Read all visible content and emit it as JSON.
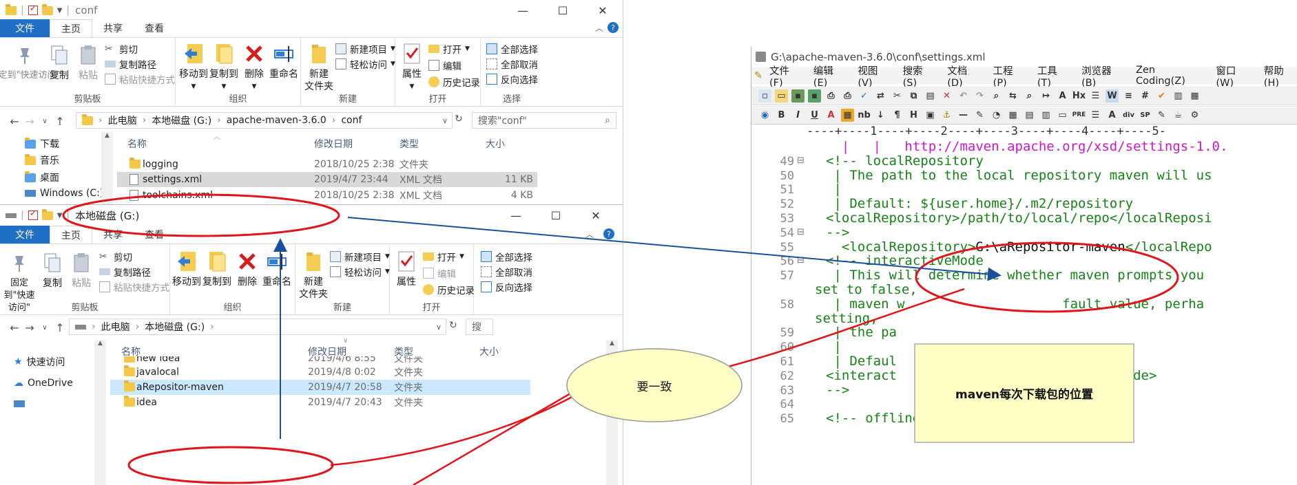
{
  "explorer1": {
    "title": "conf",
    "tabs": [
      "文件",
      "主页",
      "共享",
      "查看"
    ],
    "groups": {
      "clipboard": "剪贴板",
      "organize": "组织",
      "new": "新建",
      "open": "打开",
      "select": "选择"
    },
    "buttons": {
      "pin": "固定到\"快速访问\"",
      "copy": "复制",
      "paste": "粘贴",
      "cut": "剪切",
      "copy_path": "复制路径",
      "paste_shortcut": "粘贴快捷方式",
      "move_to": "移动到",
      "copy_to": "复制到",
      "delete": "删除",
      "rename": "重命名",
      "new_folder": "新建\n文件夹",
      "new_item": "新建项目",
      "easy_access": "轻松访问",
      "properties": "属性",
      "open": "打开",
      "edit": "编辑",
      "history": "历史记录",
      "select_all": "全部选择",
      "select_none": "全部取消",
      "invert": "反向选择"
    },
    "breadcrumb": [
      "此电脑",
      "本地磁盘 (G:)",
      "apache-maven-3.6.0",
      "conf"
    ],
    "search_placeholder": "搜索\"conf\"",
    "columns": [
      "名称",
      "修改日期",
      "类型",
      "大小"
    ],
    "nav": [
      "下载",
      "音乐",
      "桌面",
      "Windows (C:)"
    ],
    "files": [
      {
        "name": "logging",
        "date": "2018/10/25 2:38",
        "type": "文件夹",
        "size": ""
      },
      {
        "name": "settings.xml",
        "date": "2019/4/7 23:44",
        "type": "XML 文档",
        "size": "11 KB"
      },
      {
        "name": "toolchains.xml",
        "date": "2018/10/25 2:38",
        "type": "XML 文档",
        "size": "4 KB"
      }
    ]
  },
  "explorer2": {
    "title": "本地磁盘 (G:)",
    "tabs": [
      "文件",
      "主页",
      "共享",
      "查看"
    ],
    "groups": {
      "clipboard": "剪贴板",
      "organize": "组织",
      "new": "新建",
      "open": "打开"
    },
    "buttons": {
      "pin": "固定到\"快速访问\"",
      "copy": "复制",
      "paste": "粘贴",
      "cut": "剪切",
      "copy_path": "复制路径",
      "paste_shortcut": "粘贴快捷方式",
      "move_to": "移动到",
      "copy_to": "复制到",
      "delete": "删除",
      "rename": "重命名",
      "new_folder": "新建\n文件夹",
      "new_item": "新建项目",
      "easy_access": "轻松访问",
      "properties": "属性",
      "open": "打开",
      "edit": "编辑",
      "history": "历史记录",
      "select_all": "全部选择",
      "select_none": "全部取消",
      "invert": "反向选择"
    },
    "breadcrumb": [
      "此电脑",
      "本地磁盘 (G:)"
    ],
    "search_placeholder": "搜",
    "columns": [
      "名称",
      "修改日期",
      "类型",
      "大小"
    ],
    "nav": [
      "快速访问",
      "OneDrive"
    ],
    "files": [
      {
        "name": "new idea",
        "date": "2019/4/6 8:55",
        "type": "文件夹"
      },
      {
        "name": "javalocal",
        "date": "2019/4/8 0:02",
        "type": "文件夹"
      },
      {
        "name": "aRepositor-maven",
        "date": "2019/4/7 20:58",
        "type": "文件夹"
      },
      {
        "name": "idea",
        "date": "2019/4/7 20:43",
        "type": "文件夹"
      }
    ]
  },
  "editor": {
    "title": "G:\\apache-maven-3.6.0\\conf\\settings.xml",
    "menu": [
      "文件(F)",
      "编辑(E)",
      "视图(V)",
      "搜索(S)",
      "文档(D)",
      "工程(P)",
      "工具(T)",
      "浏览器(B)",
      "Zen Coding(Z)",
      "窗口(W)",
      "帮助(H)"
    ],
    "ruler": "----+----1----+----2----+----3----+----4----+----5-",
    "lines": [
      {
        "n": "",
        "text": "  |   |   http://maven.apache.org/xsd/settings-1.0.",
        "color": "mag"
      },
      {
        "n": "49",
        "text": "<!-- localRepository",
        "color": "green"
      },
      {
        "n": "50",
        "text": " | The path to the local repository maven will us",
        "color": "green"
      },
      {
        "n": "51",
        "text": " |",
        "color": "green"
      },
      {
        "n": "52",
        "text": " | Default: ${user.home}/.m2/repository",
        "color": "green"
      },
      {
        "n": "53",
        "text": "<localRepository>/path/to/local/repo</localReposi",
        "color": "green"
      },
      {
        "n": "54",
        "text": "-->",
        "color": "green"
      },
      {
        "n": "55",
        "text": "  <localRepository>G:\\aRepositor-maven</localRepo",
        "color": "mixed"
      },
      {
        "n": "56",
        "text": "<!-- interactiveMode",
        "color": "green"
      },
      {
        "n": "57",
        "text": " | This will determine whether maven prompts you ",
        "color": "green"
      },
      {
        "n": "",
        "text": "set to false,",
        "color": "green"
      },
      {
        "n": "58",
        "text": " | maven w                    fault value, perha",
        "color": "green"
      },
      {
        "n": "",
        "text": "setting,",
        "color": "green"
      },
      {
        "n": "59",
        "text": " | the pa",
        "color": "green"
      },
      {
        "n": "60",
        "text": " |",
        "color": "green"
      },
      {
        "n": "61",
        "text": " | Defaul",
        "color": "green"
      },
      {
        "n": "62",
        "text": "<interact                          veMode>",
        "color": "green"
      },
      {
        "n": "63",
        "text": "-->",
        "color": "green"
      },
      {
        "n": "64",
        "text": "",
        "color": "green"
      },
      {
        "n": "65",
        "text": "<!-- offline",
        "color": "green"
      }
    ],
    "line55": {
      "pre": "  <localRepository>",
      "value": "G:\\aRepositor-maven",
      "post": "</localRepo"
    }
  },
  "callouts": {
    "consistent": "要一致",
    "maven_location": "maven每次下载包的位置"
  },
  "colors": {
    "file_tab": "#1f6fc5",
    "annotation_red": "#e0141b",
    "annotation_blue": "#1a4f9c",
    "note_yellow": "#ffffc6",
    "code_green": "#178217",
    "code_magenta": "#d018c8",
    "selection": "#cce8ff"
  }
}
